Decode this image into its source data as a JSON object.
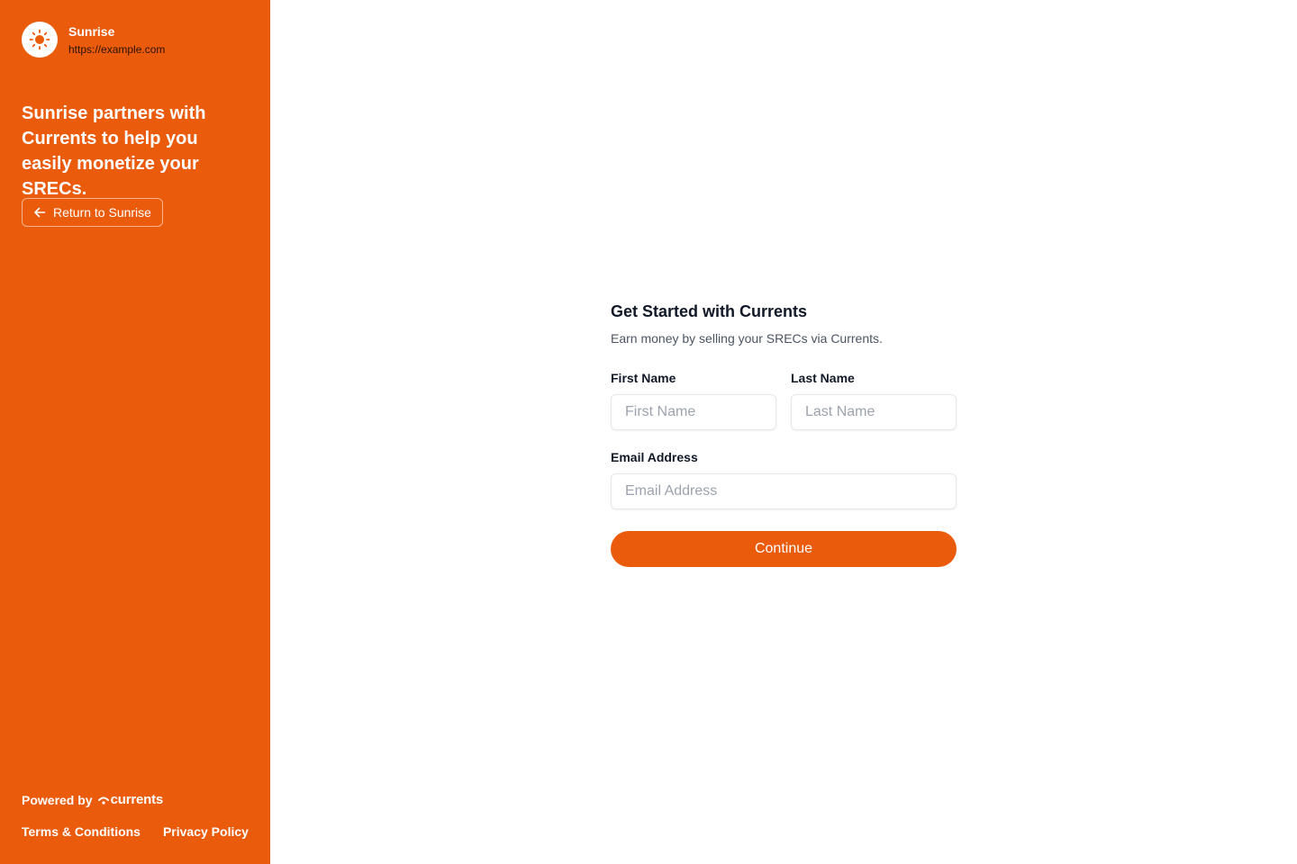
{
  "colors": {
    "brand": "#EA5B0C",
    "text_dark": "#111827",
    "text_muted": "#4b5563",
    "placeholder": "#9ca3af"
  },
  "sidebar": {
    "brand_name": "Sunrise",
    "brand_url": "https://example.com",
    "brand_icon": "sun-icon",
    "tagline": "Sunrise partners with Currents to help you easily monetize your SRECs.",
    "return_label": "Return to Sunrise",
    "return_icon": "arrow-left-icon",
    "powered_by": "Powered by",
    "powered_logo_text": "currents",
    "footer": {
      "terms": "Terms & Conditions",
      "privacy": "Privacy Policy"
    }
  },
  "form": {
    "title": "Get Started with Currents",
    "subtitle": "Earn money by selling your SRECs via Currents.",
    "first_name": {
      "label": "First Name",
      "placeholder": "First Name",
      "value": ""
    },
    "last_name": {
      "label": "Last Name",
      "placeholder": "Last Name",
      "value": ""
    },
    "email": {
      "label": "Email Address",
      "placeholder": "Email Address",
      "value": ""
    },
    "continue_label": "Continue"
  }
}
